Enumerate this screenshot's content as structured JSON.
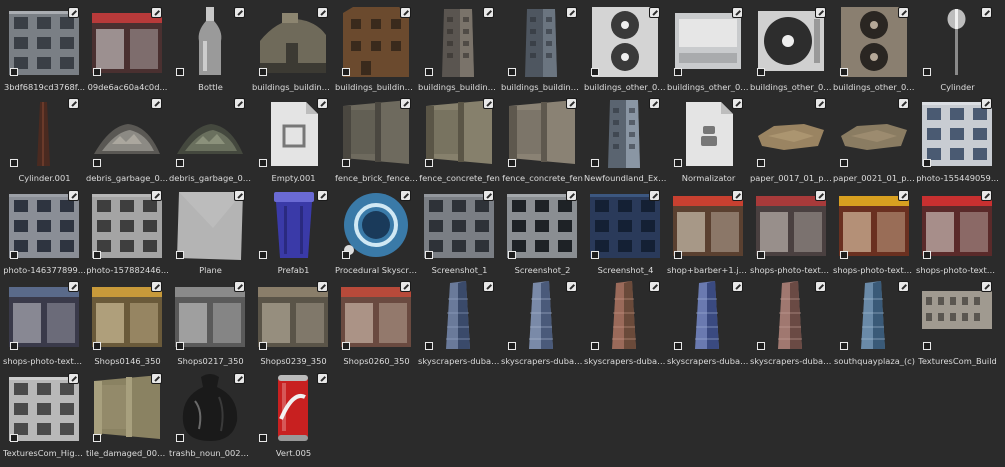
{
  "assets": [
    {
      "label": "3bdf6819cd3768f...",
      "icon": "building-facade-icon",
      "colors": [
        "#7a7f85",
        "#3a3f46",
        "#c9ccd0"
      ]
    },
    {
      "label": "09de6ac60a4c0d...",
      "icon": "storefront-icon",
      "colors": [
        "#4a3030",
        "#b83a3a",
        "#e0e0e0"
      ]
    },
    {
      "label": "Bottle",
      "icon": "bottle-icon",
      "colors": [
        "#c8c8c8",
        "#9a9a9a",
        "#ffffff"
      ]
    },
    {
      "label": "buildings_buildings...",
      "icon": "building-bunker-icon",
      "colors": [
        "#6f6a5a",
        "#8c8570",
        "#3c3a33"
      ]
    },
    {
      "label": "buildings_buildings...",
      "icon": "building-brick-ruin-icon",
      "colors": [
        "#6b4a2e",
        "#8a6a46",
        "#3a2a1c"
      ]
    },
    {
      "label": "buildings_buildings...",
      "icon": "building-tall-icon",
      "colors": [
        "#5a5550",
        "#7a736a",
        "#2f2c29"
      ]
    },
    {
      "label": "buildings_buildings...",
      "icon": "building-tall-icon",
      "colors": [
        "#4e5660",
        "#6b7580",
        "#2a2f36"
      ]
    },
    {
      "label": "buildings_other_00...",
      "icon": "ac-unit-double-icon",
      "colors": [
        "#d4d4d4",
        "#3a3a3a",
        "#f0f0f0"
      ]
    },
    {
      "label": "buildings_other_00...",
      "icon": "ac-unit-panel-icon",
      "colors": [
        "#c9cbcd",
        "#a9abad",
        "#e6e6e6"
      ]
    },
    {
      "label": "buildings_other_00...",
      "icon": "ac-unit-fan-icon",
      "colors": [
        "#d0d0d0",
        "#2d2d2d",
        "#eeeeee"
      ]
    },
    {
      "label": "buildings_other_00...",
      "icon": "ac-unit-double-icon",
      "colors": [
        "#8a7f70",
        "#2a2622",
        "#b5a898"
      ]
    },
    {
      "label": "Cylinder",
      "icon": "cylinder-pole-icon",
      "colors": [
        "#bdbdbd",
        "#8a8a8a",
        "#f0f0f0"
      ]
    },
    {
      "label": "Cylinder.001",
      "icon": "thin-pole-icon",
      "colors": [
        "#4a2a20",
        "#2a1814",
        "#6a3a2a"
      ]
    },
    {
      "label": "debris_garbage_00...",
      "icon": "debris-pile-icon",
      "colors": [
        "#8c8a84",
        "#5a5854",
        "#b8b4aa"
      ]
    },
    {
      "label": "debris_garbage_00...",
      "icon": "debris-pile-icon",
      "colors": [
        "#6a705e",
        "#44483e",
        "#9aa088"
      ]
    },
    {
      "label": "Empty.001",
      "icon": "empty-document-icon",
      "colors": [
        "#e4e4e4",
        "#bdbdbd",
        "#ffffff"
      ]
    },
    {
      "label": "fence_brick_fence_...",
      "icon": "fence-panel-icon",
      "colors": [
        "#6e6a5e",
        "#8a8676",
        "#4a4740"
      ]
    },
    {
      "label": "fence_concrete_fen",
      "icon": "fence-panel-icon",
      "colors": [
        "#86806c",
        "#a69f88",
        "#5a5546"
      ]
    },
    {
      "label": "fence_concrete_fen",
      "icon": "fence-panel-icon",
      "colors": [
        "#8a8274",
        "#a89f8e",
        "#5e584e"
      ]
    },
    {
      "label": "Newfoundland_Ext-...",
      "icon": "building-narrow-icon",
      "colors": [
        "#5a6470",
        "#8a96a4",
        "#2c323a"
      ]
    },
    {
      "label": "Normalizator",
      "icon": "node-document-icon",
      "colors": [
        "#e4e4e4",
        "#bdbdbd",
        "#ffffff"
      ]
    },
    {
      "label": "paper_0017_01_pr...",
      "icon": "paper-scrap-icon",
      "colors": [
        "#9a8462",
        "#7a6648",
        "#b8a07a"
      ]
    },
    {
      "label": "paper_0021_01_pr...",
      "icon": "paper-scrap-icon",
      "colors": [
        "#8a7c62",
        "#6a5e48",
        "#a89678"
      ]
    },
    {
      "label": "photo-155449059...",
      "icon": "building-facade-icon",
      "colors": [
        "#c8ccd2",
        "#4a5a72",
        "#e8eaee"
      ]
    },
    {
      "label": "photo-146377899...",
      "icon": "building-facade-icon",
      "colors": [
        "#8a8e96",
        "#2e3440",
        "#a8acb2"
      ]
    },
    {
      "label": "photo-157882446...",
      "icon": "building-facade-icon",
      "colors": [
        "#a4a4a4",
        "#3e3e3e",
        "#c4c4c4"
      ]
    },
    {
      "label": "Plane",
      "icon": "plane-square-icon",
      "colors": [
        "#b4b4b4",
        "#a0a0a0",
        "#c8c8c8"
      ]
    },
    {
      "label": "Prefab1",
      "icon": "trash-bin-icon",
      "colors": [
        "#3a3aa8",
        "#2a2a80",
        "#6a6ad4"
      ]
    },
    {
      "label": "Procedural Skyscra...",
      "icon": "sphere-material-icon",
      "colors": [
        "#3a7aa8",
        "#1a3a5a",
        "#d0e8f4"
      ]
    },
    {
      "label": "Screenshot_1",
      "icon": "building-facade-icon",
      "colors": [
        "#7a7e84",
        "#2e3238",
        "#a4a8ae"
      ]
    },
    {
      "label": "Screenshot_2",
      "icon": "building-facade-icon",
      "colors": [
        "#8a8e92",
        "#1e2226",
        "#b4b8bc"
      ]
    },
    {
      "label": "Screenshot_4",
      "icon": "building-facade-icon",
      "colors": [
        "#2a3a5a",
        "#142034",
        "#4a6a9a"
      ]
    },
    {
      "label": "shop+barber+1.jp...",
      "icon": "storefront-icon",
      "colors": [
        "#5a4030",
        "#c84030",
        "#e8e0d0"
      ]
    },
    {
      "label": "shops-photo-textur...",
      "icon": "storefront-icon",
      "colors": [
        "#4a4040",
        "#a83a3a",
        "#d8d0c8"
      ]
    },
    {
      "label": "shops-photo-textur...",
      "icon": "storefront-icon",
      "colors": [
        "#6a3020",
        "#d8a020",
        "#f0e0c0"
      ]
    },
    {
      "label": "shops-photo-textur...",
      "icon": "storefront-icon",
      "colors": [
        "#5a2a2a",
        "#c83030",
        "#e8e0d8"
      ]
    },
    {
      "label": "shops-photo-textur...",
      "icon": "storefront-icon",
      "colors": [
        "#3a3a4a",
        "#5a6a8a",
        "#c8c8d0"
      ]
    },
    {
      "label": "Shops0146_350",
      "icon": "storefront-icon",
      "colors": [
        "#6a5a3a",
        "#c89a3a",
        "#e8d8b0"
      ]
    },
    {
      "label": "Shops0217_350",
      "icon": "storefront-icon",
      "colors": [
        "#5a5a5a",
        "#8a8a8a",
        "#d8d8d8"
      ]
    },
    {
      "label": "Shops0239_350",
      "icon": "storefront-icon",
      "colors": [
        "#5a5448",
        "#8a7e6a",
        "#c8beac"
      ]
    },
    {
      "label": "Shops0260_350",
      "icon": "storefront-icon",
      "colors": [
        "#6a4a40",
        "#b84a3a",
        "#e0d0c0"
      ]
    },
    {
      "label": "skyscrapers-dubai-...",
      "icon": "skyscraper-icon",
      "colors": [
        "#6a7a9a",
        "#3a4a6a",
        "#9aaac8"
      ]
    },
    {
      "label": "skyscrapers-dubai-...",
      "icon": "skyscraper-icon",
      "colors": [
        "#7a8aa8",
        "#4a5a7a",
        "#aebcd4"
      ]
    },
    {
      "label": "skyscrapers-dubai-...",
      "icon": "skyscraper-icon",
      "colors": [
        "#9a6a5a",
        "#6a4a3a",
        "#c89a88"
      ]
    },
    {
      "label": "skyscrapers-dubai-...",
      "icon": "skyscraper-icon",
      "colors": [
        "#6a7ab0",
        "#3a4a80",
        "#a4b4d8"
      ]
    },
    {
      "label": "skyscrapers-dubai-...",
      "icon": "skyscraper-icon",
      "colors": [
        "#a07870",
        "#6a4a44",
        "#c8a49c"
      ]
    },
    {
      "label": "southquayplaza_(c)",
      "icon": "skyscraper-icon",
      "colors": [
        "#6a8aa8",
        "#3a5a78",
        "#a8c0d4"
      ]
    },
    {
      "label": "TexturesCom_Build",
      "icon": "building-wide-icon",
      "colors": [
        "#a09a90",
        "#5a5650",
        "#c8c2b8"
      ]
    },
    {
      "label": "TexturesCom_High...",
      "icon": "building-facade-icon",
      "colors": [
        "#b8b8b8",
        "#4a4a4a",
        "#dadada"
      ]
    },
    {
      "label": "tile_damaged_000...",
      "icon": "fence-panel-icon",
      "colors": [
        "#8a8262",
        "#6a6448",
        "#a8a07e"
      ]
    },
    {
      "label": "trashb_noun_002_...",
      "icon": "trash-bag-icon",
      "colors": [
        "#1a1a1a",
        "#3a3a3a",
        "#6a6a6a"
      ]
    },
    {
      "label": "Vert.005",
      "icon": "soda-can-icon",
      "colors": [
        "#c82020",
        "#f0f0f0",
        "#8a1010"
      ]
    }
  ]
}
